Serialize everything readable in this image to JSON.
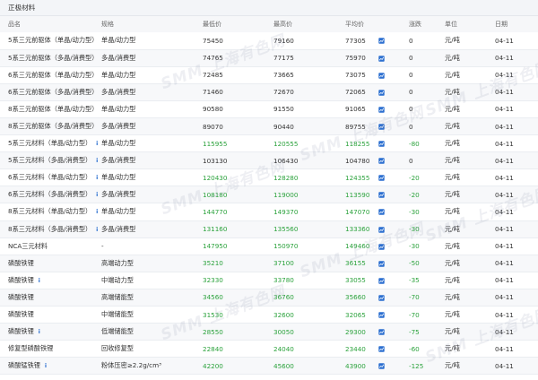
{
  "panel": {
    "title": "正极材料"
  },
  "columns": [
    "品名",
    "规格",
    "最低价",
    "最高价",
    "平均价",
    "",
    "涨跌",
    "单位",
    "日期"
  ],
  "watermark": "SMM 上海有色网",
  "colors": {
    "up": "#2ba23c",
    "flat": "#333333",
    "info": "#2c6fd0",
    "header_bg": "#f3f5f8"
  },
  "rows": [
    {
      "name": "5系三元前驱体（单晶/动力型）",
      "info": true,
      "spec": "单晶/动力型",
      "low": "75450",
      "high": "79160",
      "avg": "77305",
      "change": "0",
      "trend": "flat",
      "unit": "元/吨",
      "date": "04-11"
    },
    {
      "name": "5系三元前驱体（多晶/消费型）",
      "info": true,
      "spec": "多晶/消费型",
      "low": "74765",
      "high": "77175",
      "avg": "75970",
      "change": "0",
      "trend": "flat",
      "unit": "元/吨",
      "date": "04-11"
    },
    {
      "name": "6系三元前驱体（单晶/动力型）",
      "info": false,
      "spec": "单晶/动力型",
      "low": "72485",
      "high": "73665",
      "avg": "73075",
      "change": "0",
      "trend": "flat",
      "unit": "元/吨",
      "date": "04-11"
    },
    {
      "name": "6系三元前驱体（多晶/消费型）",
      "info": false,
      "spec": "多晶/消费型",
      "low": "71460",
      "high": "72670",
      "avg": "72065",
      "change": "0",
      "trend": "flat",
      "unit": "元/吨",
      "date": "04-11"
    },
    {
      "name": "8系三元前驱体（单晶/动力型）",
      "info": false,
      "spec": "单晶/动力型",
      "low": "90580",
      "high": "91550",
      "avg": "91065",
      "change": "0",
      "trend": "flat",
      "unit": "元/吨",
      "date": "04-11"
    },
    {
      "name": "8系三元前驱体（多晶/消费型）",
      "info": false,
      "spec": "多晶/消费型",
      "low": "89070",
      "high": "90440",
      "avg": "89755",
      "change": "0",
      "trend": "flat",
      "unit": "元/吨",
      "date": "04-11"
    },
    {
      "name": "5系三元材料（单晶/动力型）",
      "info": true,
      "spec": "单晶/动力型",
      "low": "115955",
      "high": "120555",
      "avg": "118255",
      "change": "-80",
      "trend": "up",
      "unit": "元/吨",
      "date": "04-11"
    },
    {
      "name": "5系三元材料（多晶/消费型）",
      "info": true,
      "spec": "多晶/消费型",
      "low": "103130",
      "high": "106430",
      "avg": "104780",
      "change": "0",
      "trend": "flat",
      "unit": "元/吨",
      "date": "04-11"
    },
    {
      "name": "6系三元材料（单晶/动力型）",
      "info": true,
      "spec": "单晶/动力型",
      "low": "120430",
      "high": "128280",
      "avg": "124355",
      "change": "-20",
      "trend": "up",
      "unit": "元/吨",
      "date": "04-11"
    },
    {
      "name": "6系三元材料（多晶/消费型）",
      "info": true,
      "spec": "多晶/消费型",
      "low": "108180",
      "high": "119000",
      "avg": "113590",
      "change": "-20",
      "trend": "up",
      "unit": "元/吨",
      "date": "04-11"
    },
    {
      "name": "8系三元材料（单晶/动力型）",
      "info": true,
      "spec": "单晶/动力型",
      "low": "144770",
      "high": "149370",
      "avg": "147070",
      "change": "-30",
      "trend": "up",
      "unit": "元/吨",
      "date": "04-11"
    },
    {
      "name": "8系三元材料（多晶/消费型）",
      "info": true,
      "spec": "多晶/消费型",
      "low": "131160",
      "high": "135560",
      "avg": "133360",
      "change": "-30",
      "trend": "up",
      "unit": "元/吨",
      "date": "04-11"
    },
    {
      "name": "NCA三元材料",
      "info": false,
      "spec": "-",
      "low": "147950",
      "high": "150970",
      "avg": "149460",
      "change": "-30",
      "trend": "up",
      "unit": "元/吨",
      "date": "04-11"
    },
    {
      "name": "磷酸铁锂",
      "info": false,
      "spec": "高端动力型",
      "low": "35210",
      "high": "37100",
      "avg": "36155",
      "change": "-50",
      "trend": "up",
      "unit": "元/吨",
      "date": "04-11"
    },
    {
      "name": "磷酸铁锂",
      "info": true,
      "spec": "中端动力型",
      "low": "32330",
      "high": "33780",
      "avg": "33055",
      "change": "-35",
      "trend": "up",
      "unit": "元/吨",
      "date": "04-11"
    },
    {
      "name": "磷酸铁锂",
      "info": false,
      "spec": "高端储能型",
      "low": "34560",
      "high": "36760",
      "avg": "35660",
      "change": "-70",
      "trend": "up",
      "unit": "元/吨",
      "date": "04-11"
    },
    {
      "name": "磷酸铁锂",
      "info": false,
      "spec": "中端储能型",
      "low": "31530",
      "high": "32600",
      "avg": "32065",
      "change": "-70",
      "trend": "up",
      "unit": "元/吨",
      "date": "04-11"
    },
    {
      "name": "磷酸铁锂",
      "info": true,
      "spec": "低端储能型",
      "low": "28550",
      "high": "30050",
      "avg": "29300",
      "change": "-75",
      "trend": "up",
      "unit": "元/吨",
      "date": "04-11"
    },
    {
      "name": "修复型磷酸铁锂",
      "info": false,
      "spec": "回收修复型",
      "low": "22840",
      "high": "24040",
      "avg": "23440",
      "change": "-60",
      "trend": "up",
      "unit": "元/吨",
      "date": "04-11"
    },
    {
      "name": "磷酸锰铁锂",
      "info": true,
      "spec": "粉体压密≥2.2g/cm³",
      "low": "42200",
      "high": "45600",
      "avg": "43900",
      "change": "-125",
      "trend": "up",
      "unit": "元/吨",
      "date": "04-11"
    }
  ]
}
